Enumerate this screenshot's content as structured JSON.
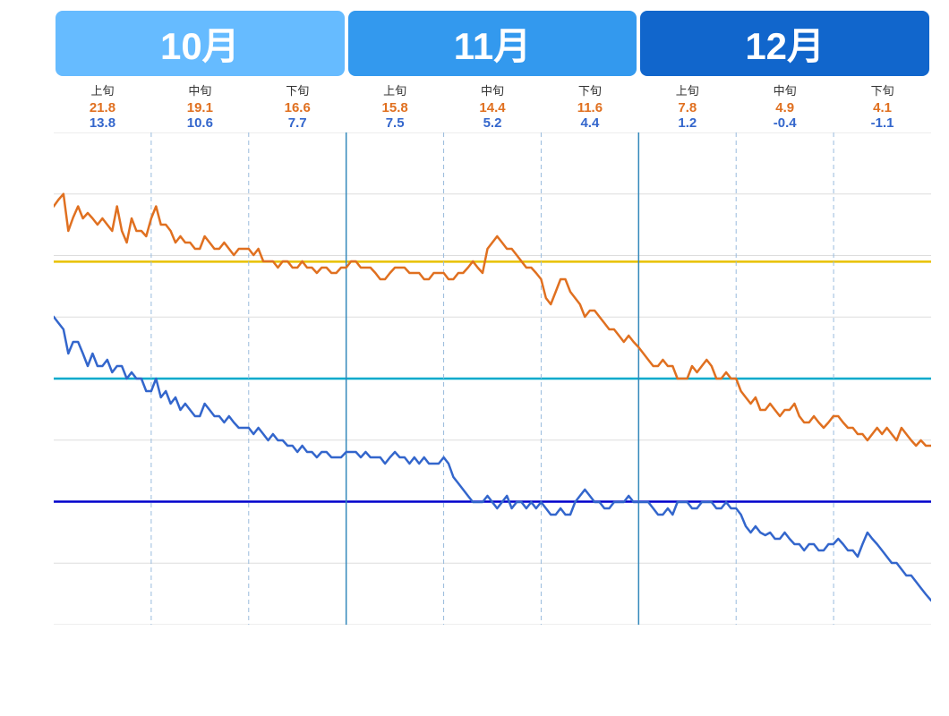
{
  "months": [
    {
      "label": "10月",
      "class": "month-oct"
    },
    {
      "label": "11月",
      "class": "month-nov"
    },
    {
      "label": "12月",
      "class": "month-dec"
    }
  ],
  "periods": [
    {
      "label": "上旬",
      "high": "21.8",
      "low": "13.8"
    },
    {
      "label": "中旬",
      "high": "19.1",
      "low": "10.6"
    },
    {
      "label": "下旬",
      "high": "16.6",
      "low": "7.7"
    },
    {
      "label": "上旬",
      "high": "15.8",
      "low": "7.5"
    },
    {
      "label": "中旬",
      "high": "14.4",
      "low": "5.2"
    },
    {
      "label": "下旬",
      "high": "11.6",
      "low": "4.4"
    },
    {
      "label": "上旬",
      "high": "7.8",
      "low": "1.2"
    },
    {
      "label": "中旬",
      "high": "4.9",
      "low": "-0.4"
    },
    {
      "label": "下旬",
      "high": "4.1",
      "low": "-1.1"
    }
  ],
  "yAxis": {
    "min": -10,
    "max": 30,
    "ticks": [
      30,
      25,
      20,
      15,
      10,
      5,
      0,
      -5,
      -10
    ]
  },
  "referenceLines": [
    {
      "value": 19.5,
      "color": "#E8C000"
    },
    {
      "value": 10,
      "color": "#00AACC"
    },
    {
      "value": 0,
      "color": "#0000CC"
    }
  ]
}
